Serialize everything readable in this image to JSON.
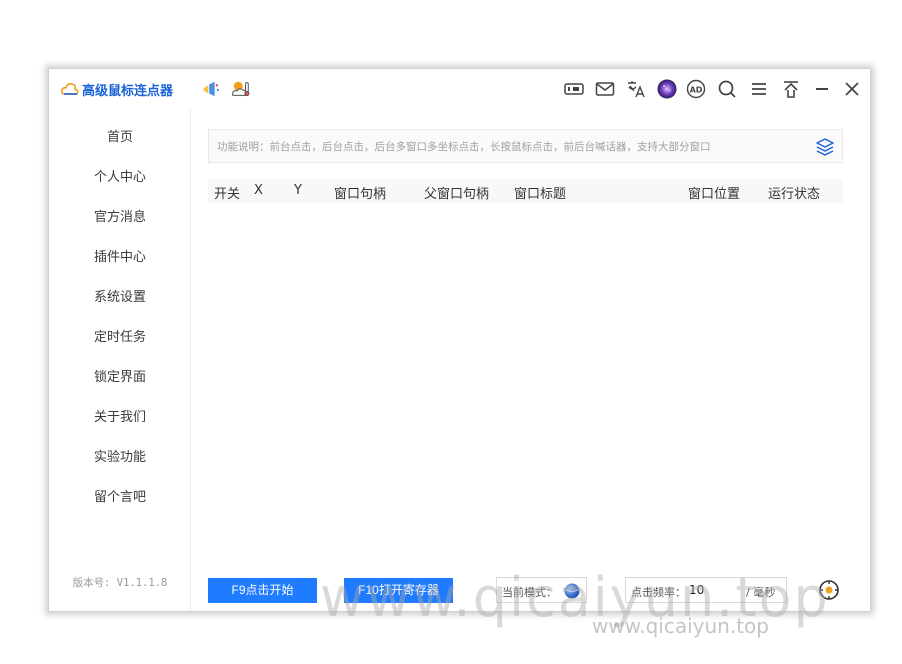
{
  "app": {
    "title": "高级鼠标连点器"
  },
  "colors": {
    "accent": "#1f7bff",
    "title_blue": "#1a63d8",
    "nav_text": "#3a3a3a",
    "muted": "#a0a0a0"
  },
  "titlebar_icons": [
    "announcement-icon",
    "thermometer-weather-icon",
    "keyboard-icon",
    "mail-icon",
    "translate-icon",
    "galaxy-avatar-icon",
    "ad-icon",
    "search-icon",
    "menu-icon",
    "pin-top-icon",
    "minimize-icon",
    "close-icon"
  ],
  "sidebar": {
    "items": [
      {
        "label": "首页"
      },
      {
        "label": "个人中心"
      },
      {
        "label": "官方消息"
      },
      {
        "label": "插件中心"
      },
      {
        "label": "系统设置"
      },
      {
        "label": "定时任务"
      },
      {
        "label": "锁定界面"
      },
      {
        "label": "关于我们"
      },
      {
        "label": "实验功能"
      },
      {
        "label": "留个言吧"
      }
    ],
    "version": "版本号: V1.1.1.8"
  },
  "description": {
    "text": "功能说明：前台点击，后台点击，后台多窗口多坐标点击，长按鼠标点击，前后台喊话器，支持大部分窗口"
  },
  "table": {
    "columns": [
      "开关",
      "X",
      "Y",
      "窗口句柄",
      "父窗口句柄",
      "窗口标题",
      "窗口位置",
      "运行状态"
    ],
    "rows": []
  },
  "footer": {
    "start_button": "F9点击开始",
    "recorder_button": "F10打开寄存器",
    "mode_label": "当前模式：",
    "freq_label": "点击频率：",
    "freq_value": "10",
    "freq_unit": "/ 毫秒"
  },
  "watermark": {
    "large": "www.qicaiyun.top",
    "small": "www.qicaiyun.top"
  }
}
